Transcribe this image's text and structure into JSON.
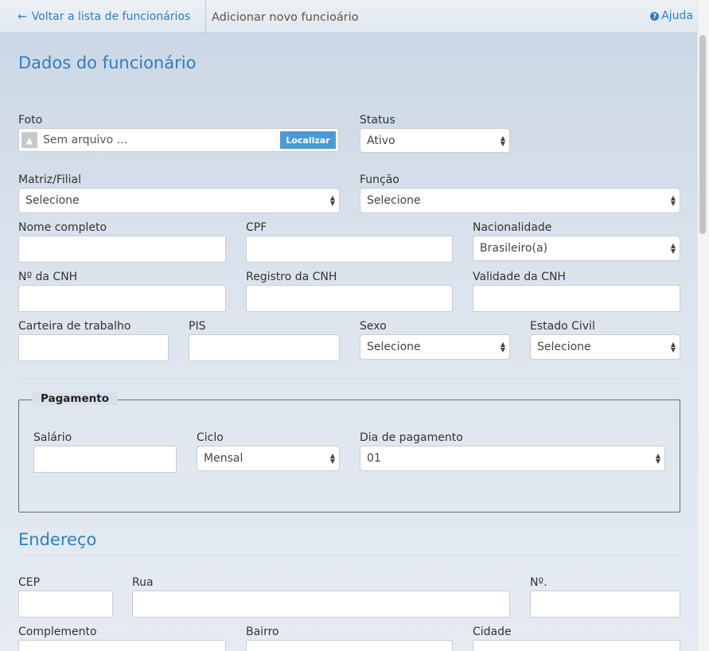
{
  "topbar": {
    "back_label": "Voltar a lista de funcionários",
    "back_icon": "arrow-left-icon",
    "title": "Adicionar novo funcioário",
    "help_label": "Ajuda",
    "help_icon": "question-circle-icon"
  },
  "section_employee": {
    "title": "Dados do funcionário"
  },
  "photo": {
    "label": "Foto",
    "file_name": "Sem arquivo ...",
    "browse_label": "Localizar",
    "upload_icon": "upload-icon"
  },
  "status": {
    "label": "Status",
    "value": "Ativo"
  },
  "branch": {
    "label": "Matriz/Filial",
    "value": "Selecione"
  },
  "role": {
    "label": "Função",
    "value": "Selecione"
  },
  "full_name": {
    "label": "Nome completo",
    "value": ""
  },
  "cpf": {
    "label": "CPF",
    "value": ""
  },
  "nationality": {
    "label": "Nacionalidade",
    "value": "Brasileiro(a)"
  },
  "cnh_number": {
    "label": "Nº da CNH",
    "value": ""
  },
  "cnh_registry": {
    "label": "Registro da CNH",
    "value": ""
  },
  "cnh_validity": {
    "label": "Validade da CNH",
    "value": ""
  },
  "work_card": {
    "label": "Carteira de trabalho",
    "value": ""
  },
  "pis": {
    "label": "PIS",
    "value": ""
  },
  "sex": {
    "label": "Sexo",
    "value": "Selecione"
  },
  "civil_status": {
    "label": "Estado Civil",
    "value": "Selecione"
  },
  "payment": {
    "legend": "Pagamento",
    "salary": {
      "label": "Salário",
      "value": ""
    },
    "cycle": {
      "label": "Ciclo",
      "value": "Mensal"
    },
    "pay_day": {
      "label": "Dia de pagamento",
      "value": "01"
    }
  },
  "section_address": {
    "title": "Endereço"
  },
  "address": {
    "cep": {
      "label": "CEP",
      "value": ""
    },
    "street": {
      "label": "Rua",
      "value": ""
    },
    "number": {
      "label": "Nº.",
      "value": ""
    },
    "complement": {
      "label": "Complemento",
      "value": ""
    },
    "district": {
      "label": "Bairro",
      "value": ""
    },
    "city": {
      "label": "Cidade",
      "value": ""
    }
  },
  "colors": {
    "accent": "#2f7fc1",
    "browse_button": "#4a9ad4"
  }
}
